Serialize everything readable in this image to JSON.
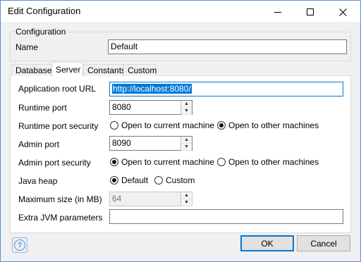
{
  "window": {
    "title": "Edit Configuration",
    "minimize_icon": "minimize-icon",
    "maximize_icon": "maximize-icon",
    "close_icon": "close-icon"
  },
  "configuration_group": {
    "legend": "Configuration",
    "name_label": "Name",
    "name_value": "Default"
  },
  "tabs": [
    {
      "label": "Database",
      "active": false
    },
    {
      "label": "Server",
      "active": true
    },
    {
      "label": "Constants",
      "active": false
    },
    {
      "label": "Custom",
      "active": false
    }
  ],
  "server": {
    "app_root_url": {
      "label": "Application root URL",
      "value": "http://localhost:8080/"
    },
    "runtime_port": {
      "label": "Runtime port",
      "value": "8080"
    },
    "runtime_port_security": {
      "label": "Runtime port security",
      "options": [
        {
          "label": "Open to current machine",
          "selected": false
        },
        {
          "label": "Open to other machines",
          "selected": true
        }
      ]
    },
    "admin_port": {
      "label": "Admin port",
      "value": "8090"
    },
    "admin_port_security": {
      "label": "Admin port security",
      "options": [
        {
          "label": "Open to current machine",
          "selected": true
        },
        {
          "label": "Open to other machines",
          "selected": false
        }
      ]
    },
    "java_heap": {
      "label": "Java heap",
      "options": [
        {
          "label": "Default",
          "selected": true
        },
        {
          "label": "Custom",
          "selected": false
        }
      ]
    },
    "max_size": {
      "label": "Maximum size (in MB)",
      "value": "64",
      "disabled": true
    },
    "extra_jvm": {
      "label": "Extra JVM parameters",
      "value": ""
    }
  },
  "footer": {
    "help_icon": "help-icon",
    "ok_label": "OK",
    "cancel_label": "Cancel"
  },
  "colors": {
    "accent": "#0078d7",
    "window_border": "#5a8fd1",
    "background": "#f0f0f0"
  }
}
